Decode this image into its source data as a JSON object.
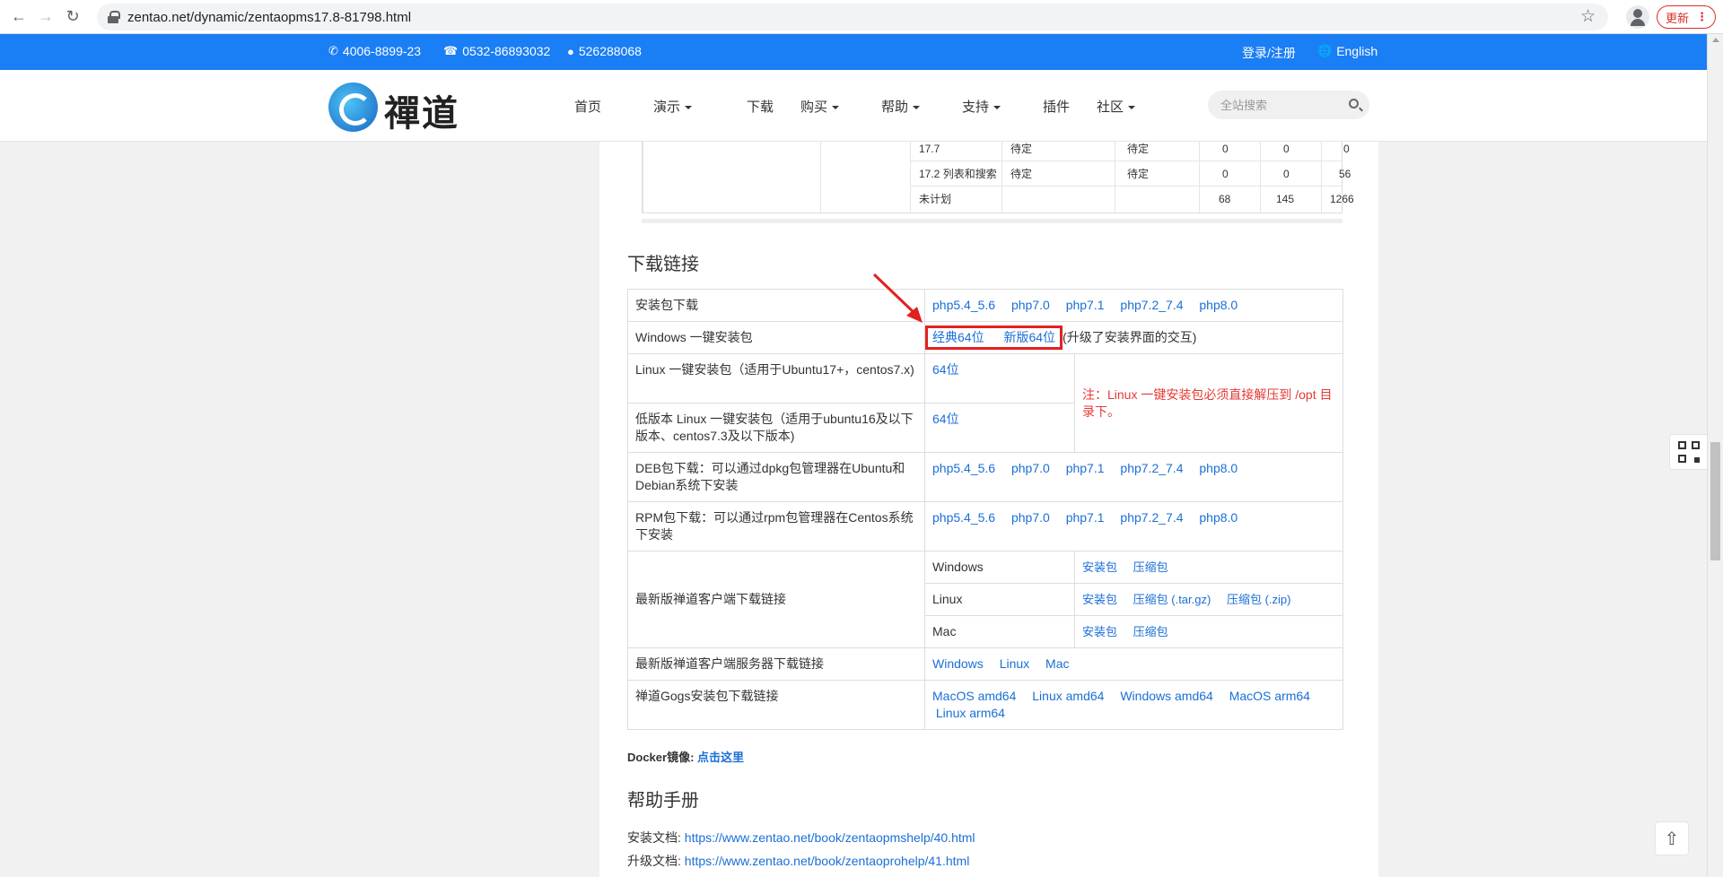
{
  "browser": {
    "url": "zentao.net/dynamic/zentaopms17.8-81798.html",
    "update_label": "更新"
  },
  "topbar": {
    "hotline": "4006-8899-23",
    "phone": "0532-86893032",
    "qq": "526288068",
    "login": "登录/注册",
    "language": "English"
  },
  "logo": {
    "text": "禪道"
  },
  "nav": {
    "items": [
      "首页",
      "演示",
      "下载",
      "购买",
      "帮助",
      "支持",
      "插件",
      "社区"
    ]
  },
  "search": {
    "placeholder": "全站搜索"
  },
  "plan_table": {
    "rows": [
      {
        "name": "17.7",
        "status1": "待定",
        "status2": "待定",
        "n1": "0",
        "n2": "0",
        "n3": "0"
      },
      {
        "name": "17.2 列表和搜索",
        "status1": "待定",
        "status2": "待定",
        "n1": "0",
        "n2": "0",
        "n3": "56"
      },
      {
        "name": "未计划",
        "status1": "",
        "status2": "",
        "n1": "68",
        "n2": "145",
        "n3": "1266"
      }
    ]
  },
  "downloads": {
    "title": "下载链接",
    "pkg_label": "安装包下载",
    "php_links": [
      "php5.4_5.6",
      "php7.0",
      "php7.1",
      "php7.2_7.4",
      "php8.0"
    ],
    "windows_label": "Windows 一键安装包",
    "windows_links": [
      "经典64位",
      "新版64位"
    ],
    "windows_note": "(升级了安装界面的交互)",
    "linux_label": "Linux 一键安装包（适用于Ubuntu17+，centos7.x)",
    "linux_link": "64位",
    "linux_note": "注：Linux 一键安装包必须直接解压到 /opt 目录下。",
    "linux_old_label": "低版本 Linux 一键安装包（适用于ubuntu16及以下版本、centos7.3及以下版本)",
    "linux_old_link": "64位",
    "deb_label": "DEB包下载：可以通过dpkg包管理器在Ubuntu和Debian系统下安装",
    "rpm_label": "RPM包下载：可以通过rpm包管理器在Centos系统下安装",
    "client_label": "最新版禅道客户端下载链接",
    "client_windows": "Windows",
    "client_linux": "Linux",
    "client_mac": "Mac",
    "installer": "安装包",
    "zip": "压缩包",
    "targz": "压缩包 (.tar.gz)",
    "zipfmt": "压缩包 (.zip)",
    "client_server_label": "最新版禅道客户端服务器下载链接",
    "server_links": [
      "Windows",
      "Linux",
      "Mac"
    ],
    "gogs_label": "禅道Gogs安装包下载链接",
    "gogs_links": [
      "MacOS amd64",
      "Linux amd64",
      "Windows amd64",
      "MacOS arm64",
      "Linux arm64"
    ]
  },
  "docker": {
    "label": "Docker镜像:",
    "link": "点击这里"
  },
  "help": {
    "title": "帮助手册",
    "install_label": "安装文档:",
    "install_link": "https://www.zentao.net/book/zentaopmshelp/40.html",
    "upgrade_label": "升级文档:",
    "upgrade_link": "https://www.zentao.net/book/zentaoprohelp/41.html"
  },
  "colors": {
    "brand_blue": "#1a7ef5",
    "link": "#1a6fd6",
    "highlight_red": "#e32020"
  }
}
